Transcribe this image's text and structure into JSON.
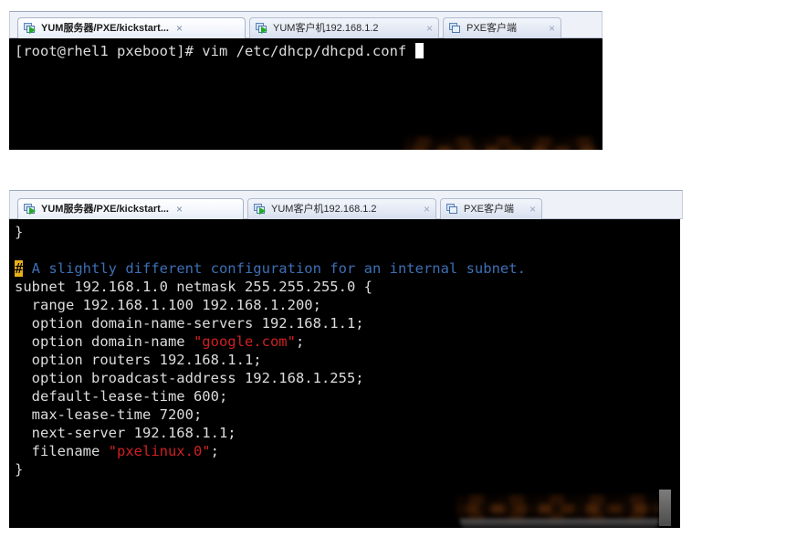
{
  "app": {
    "type": "ssh-terminal-client",
    "theme": {
      "terminal_bg": "#000000",
      "terminal_fg": "#d9d9d9",
      "comment_color": "#3d6fb5",
      "string_color": "#cf2020",
      "cursor_highlight": "#e8b019",
      "tabbar_bg": "#eef1f7"
    }
  },
  "panel_top": {
    "tabs": [
      {
        "label": "YUM服务器/PXE/kickstart...",
        "close": "×",
        "icon": "terminal-session-running-icon",
        "active": true
      },
      {
        "label": "YUM客户机192.168.1.2",
        "close": "×",
        "icon": "terminal-session-running-icon",
        "active": false
      },
      {
        "label": "PXE客户端",
        "close": "×",
        "icon": "terminal-session-icon",
        "active": false
      }
    ],
    "terminal": {
      "lines": [
        {
          "segments": [
            {
              "text": "[root@rhel1 pxeboot]# vim /etc/dhcp/dhcpd.conf ",
              "style": "plain"
            },
            {
              "text": "█",
              "style": "cursor"
            }
          ]
        }
      ],
      "redaction_note": "blurred-region"
    }
  },
  "panel_bottom": {
    "tabs": [
      {
        "label": "YUM服务器/PXE/kickstart...",
        "close": "×",
        "icon": "terminal-session-running-icon",
        "active": true
      },
      {
        "label": "YUM客户机192.168.1.2",
        "close": "×",
        "icon": "terminal-session-running-icon",
        "active": false
      },
      {
        "label": "PXE客户端",
        "close": "×",
        "icon": "terminal-session-icon",
        "active": false
      }
    ],
    "terminal": {
      "file": "/etc/dhcp/dhcpd.conf",
      "lines": [
        {
          "segments": [
            {
              "text": "}",
              "style": "plain"
            }
          ]
        },
        {
          "segments": [
            {
              "text": "",
              "style": "plain"
            }
          ]
        },
        {
          "segments": [
            {
              "text": "#",
              "style": "cursor-hl"
            },
            {
              "text": " A slightly different configuration for an internal subnet.",
              "style": "comment"
            }
          ]
        },
        {
          "segments": [
            {
              "text": "subnet 192.168.1.0 netmask 255.255.255.0 {",
              "style": "plain"
            }
          ]
        },
        {
          "segments": [
            {
              "text": "  range 192.168.1.100 192.168.1.200;",
              "style": "plain"
            }
          ]
        },
        {
          "segments": [
            {
              "text": "  option domain-name-servers 192.168.1.1;",
              "style": "plain"
            }
          ]
        },
        {
          "segments": [
            {
              "text": "  option domain-name ",
              "style": "plain"
            },
            {
              "text": "\"google.com\"",
              "style": "string"
            },
            {
              "text": ";",
              "style": "plain"
            }
          ]
        },
        {
          "segments": [
            {
              "text": "  option routers 192.168.1.1;",
              "style": "plain"
            }
          ]
        },
        {
          "segments": [
            {
              "text": "  option broadcast-address 192.168.1.255;",
              "style": "plain"
            }
          ]
        },
        {
          "segments": [
            {
              "text": "  default-lease-time 600;",
              "style": "plain"
            }
          ]
        },
        {
          "segments": [
            {
              "text": "  max-lease-time 7200;",
              "style": "plain"
            }
          ]
        },
        {
          "segments": [
            {
              "text": "  next-server 192.168.1.1;",
              "style": "plain"
            }
          ]
        },
        {
          "segments": [
            {
              "text": "  filename ",
              "style": "plain"
            },
            {
              "text": "\"pxelinux.0\"",
              "style": "string"
            },
            {
              "text": ";",
              "style": "plain"
            }
          ]
        },
        {
          "segments": [
            {
              "text": "}",
              "style": "plain"
            }
          ]
        }
      ],
      "redaction_note": "blurred-region"
    }
  }
}
